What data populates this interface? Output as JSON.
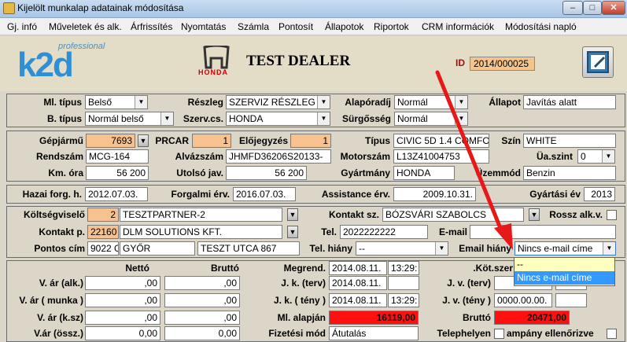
{
  "window": {
    "title": "Kijelölt munkalap adatainak módosítása",
    "btn_min": "–",
    "btn_max": "□",
    "btn_close": "✕"
  },
  "menu": [
    "Gj. infó",
    "Műveletek és alk.",
    "Árfrissítés",
    "Nyomtatás",
    "Számla",
    "Pontosít",
    "Állapotok",
    "Riportok",
    "CRM információk",
    "Módosítási napló"
  ],
  "logo": {
    "small": "professional",
    "big": "k2d"
  },
  "honda": "HONDA",
  "dealer": "TEST DEALER",
  "id": {
    "label": "ID",
    "value": "2014/000025"
  },
  "p1": {
    "ml_tipus_l": "Ml. típus",
    "ml_tipus": "Belső",
    "reszleg_l": "Részleg",
    "reszleg": "SZERVIZ RÉSZLEG",
    "alapora_l": "Alapóradíj",
    "alapora": "Normál",
    "allapot_l": "Állapot",
    "allapot": "Javítás alatt",
    "b_tipus_l": "B. típus",
    "b_tipus": "Normál belső",
    "szerv_l": "Szerv.cs.",
    "szerv": "HONDA",
    "surg_l": "Sürgősség",
    "surg": "Normál"
  },
  "p2": {
    "gepjarmu_l": "Gépjármű",
    "gepjarmu": "7693",
    "prcar_l": "PRCAR",
    "prcar": "1",
    "eloj_l": "Előjegyzés",
    "eloj": "1",
    "tipus_l": "Típus",
    "tipus": "CIVIC 5D 1.4 COMFO",
    "szin_l": "Szín",
    "szin": "WHITE",
    "rendszam_l": "Rendszám",
    "rendszam": "MCG-164",
    "alvaz_l": "Alvázszám",
    "alvaz": "JHMFD36206S20133-",
    "motor_l": "Motorszám",
    "motor": "L13Z41004753",
    "uaszint_l": "Üa.szint",
    "uaszint": "0",
    "km_l": "Km. óra",
    "km": "56 200",
    "utolso_l": "Utolsó jav.",
    "utolso": "56 200",
    "gyartmany_l": "Gyártmány",
    "gyartmany": "HONDA",
    "uzemmod_l": "Üzemmód",
    "uzemmod": "Benzin"
  },
  "p3": {
    "hazai_l": "Hazai forg. h.",
    "hazai": "2012.07.03.",
    "forg_l": "Forgalmi érv.",
    "forg": "2016.07.03.",
    "assist_l": "Assistance érv.",
    "assist": "2009.10.31.",
    "gyartev_l": "Gyártási év",
    "gyartev": "2013"
  },
  "p4": {
    "koltseg_l": "Költségviselő",
    "koltseg_id": "2",
    "koltseg": "TESZTPARTNER-2",
    "kontaktsz_l": "Kontakt sz.",
    "kontaktsz": "BÓZSVÁRI SZABOLCS",
    "rossz_l": "Rossz alk.v.",
    "kontaktp_l": "Kontakt p.",
    "kontaktp_id": "22160",
    "kontaktp": "DLM SOLUTIONS KFT.",
    "tel_l": "Tel.",
    "tel": "2022222222",
    "email_l": "E-mail",
    "email": "",
    "pontos_l": "Pontos cím",
    "irsz": "9022 G",
    "varos": "GYŐR",
    "utca": "TESZT UTCA 867",
    "telhiany_l": "Tel. hiány",
    "telhiany": "--",
    "emailhiany_l": "Email hiány",
    "emailhiany": "Nincs e-mail címe",
    "dropdown": [
      "--",
      "Nincs e-mail címe"
    ]
  },
  "p5": {
    "netto_h": "Nettó",
    "brutto_h": "Bruttó",
    "var_alk_l": "V. ár (alk.)",
    "var_alk_n": ",00",
    "var_alk_b": ",00",
    "var_munka_l": "V. ár ( munka )",
    "var_munka_n": ",00",
    "var_munka_b": ",00",
    "var_ksz_l": "V. ár (k.sz)",
    "var_ksz_n": ",00",
    "var_ksz_b": ",00",
    "var_ossz_l": "V.ár (össz.)",
    "var_ossz_n": "0,00",
    "var_ossz_b": "0,00",
    "megrend_l": "Megrend.",
    "megrend_d": "2014.08.11.",
    "megrend_t": "13:29:",
    "jk_terv_l": "J. k. (terv)",
    "jk_terv_d": "2014.08.11.",
    "jk_terv_t": "",
    "jk_teny_l": "J. k. ( tény )",
    "jk_teny_d": "2014.08.11.",
    "jk_teny_t": "13:29:",
    "ml_alap_l": "Ml. alapján",
    "ml_alap": "16119,00",
    "fiz_l": "Fizetési mód",
    "fiz": "Átutalás",
    "kotsz_l": ".Köt.szer",
    "jv_terv_l": "J. v. (terv)",
    "jv_terv_d": "",
    "jv_terv_t": "",
    "jv_teny_l": "J. v. (tény )",
    "jv_teny_d": "0000.00.00.",
    "jv_teny_t": "",
    "brutto_l": "Bruttó",
    "brutto": "20471,00",
    "telephely_l": "Telephelyen",
    "kampany_l": "ampány ellenőrizve"
  },
  "colors": {
    "accent": "#f7c28f",
    "alert": "#ff1010",
    "selection": "#3399ff",
    "arrow": "#e81818"
  }
}
